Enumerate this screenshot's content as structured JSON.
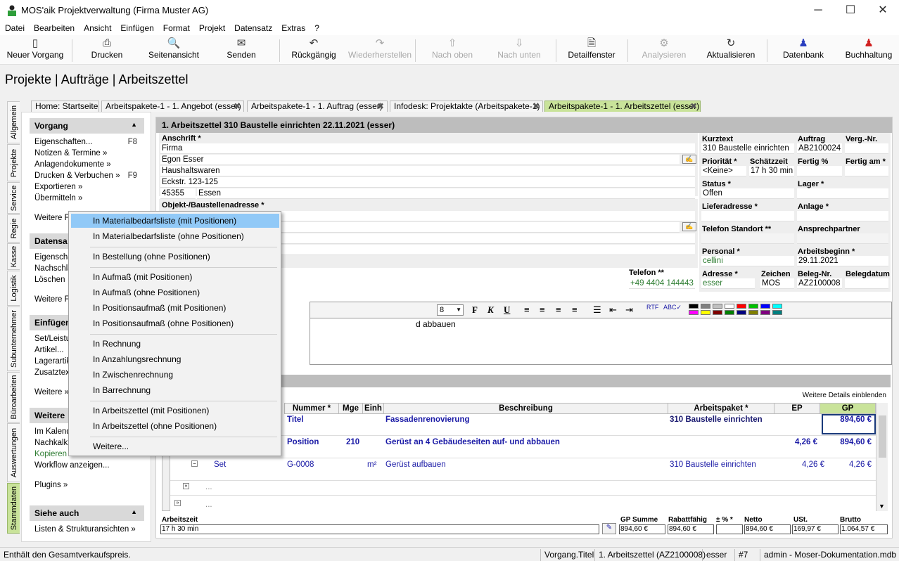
{
  "window": {
    "title": "MOS'aik Projektverwaltung (Firma Muster AG)",
    "minimize": "─",
    "maximize": "☐",
    "close": "✕"
  },
  "menu": [
    "Datei",
    "Bearbeiten",
    "Ansicht",
    "Einfügen",
    "Format",
    "Projekt",
    "Datensatz",
    "Extras",
    "?"
  ],
  "toolbar": [
    {
      "label": "Neuer Vorgang",
      "icon": "new-document-icon",
      "glyph": "▯",
      "enabled": true
    },
    {
      "label": "Drucken",
      "icon": "printer-icon",
      "glyph": "⎙",
      "enabled": true
    },
    {
      "label": "Seitenansicht",
      "icon": "preview-icon",
      "glyph": "🔍",
      "enabled": true
    },
    {
      "label": "Senden",
      "icon": "mail-icon",
      "glyph": "✉",
      "enabled": true
    },
    {
      "label": "Rückgängig",
      "icon": "undo-icon",
      "glyph": "↶",
      "enabled": true
    },
    {
      "label": "Wiederherstellen",
      "icon": "redo-icon",
      "glyph": "↷",
      "enabled": false
    },
    {
      "label": "Nach oben",
      "icon": "arrow-up-icon",
      "glyph": "⇧",
      "enabled": false
    },
    {
      "label": "Nach unten",
      "icon": "arrow-down-icon",
      "glyph": "⇩",
      "enabled": false
    },
    {
      "label": "Detailfenster",
      "icon": "detail-window-icon",
      "glyph": "🗎",
      "enabled": true
    },
    {
      "label": "Analysieren",
      "icon": "analyze-icon",
      "glyph": "⚙",
      "enabled": false
    },
    {
      "label": "Aktualisieren",
      "icon": "refresh-icon",
      "glyph": "↻",
      "enabled": true
    },
    {
      "label": "Datenbank",
      "icon": "database-icon",
      "glyph": "♟",
      "enabled": true
    },
    {
      "label": "Buchhaltung",
      "icon": "accounting-icon",
      "glyph": "♟",
      "enabled": true
    }
  ],
  "breadcrumb": "Projekte | Aufträge | Arbeitszettel",
  "vertical_tabs": [
    "Allgemein",
    "Projekte",
    "Service",
    "Regie",
    "Kasse",
    "Logistik",
    "Subunternehmer",
    "Büroarbeiten",
    "Auswertungen",
    "Stammdaten"
  ],
  "tabs": [
    {
      "label": "Home: Startseite",
      "close": ""
    },
    {
      "label": "Arbeitspakete-1 - 1. Angebot (esser)",
      "close": "✖"
    },
    {
      "label": "Arbeitspakete-1 - 1. Auftrag (esser)",
      "close": "✖"
    },
    {
      "label": "Infodesk: Projektakte (Arbeitspakete-1)",
      "close": "✖"
    },
    {
      "label": "Arbeitspakete-1 - 1. Arbeitszettel (esser)",
      "close": "✖"
    }
  ],
  "left": {
    "vorgang": {
      "title": "Vorgang",
      "items": [
        {
          "label": "Eigenschaften...",
          "key": "F8"
        },
        {
          "label": "Notizen & Termine »",
          "key": ""
        },
        {
          "label": "Anlagendokumente »",
          "key": ""
        },
        {
          "label": "Drucken & Verbuchen »",
          "key": "F9"
        },
        {
          "label": "Exportieren »",
          "key": ""
        },
        {
          "label": "Übermitteln »",
          "key": ""
        }
      ],
      "more": "Weitere Fu"
    },
    "datensatz": {
      "title": "Datensa",
      "items": [
        "Eigenscha",
        "Nachschla",
        "Löschen"
      ],
      "more": "Weitere Fu"
    },
    "einfuegen": {
      "title": "Einfügen",
      "items": [
        "Set/Leistu",
        "Artikel...",
        "Lagerartik",
        "Zusatztex"
      ],
      "more": "Weitere »"
    },
    "weitere": {
      "title": "Weitere",
      "items": [
        "Im Kalend",
        "Nachkalku",
        "Kopieren »",
        "Workflow anzeigen..."
      ],
      "more": "Plugins »"
    },
    "siehe": {
      "title": "Siehe auch",
      "items": [
        "Listen & Strukturansichten »"
      ]
    }
  },
  "main": {
    "title": "1. Arbeitszettel 310 Baustelle einrichten 22.11.2021 (esser)",
    "anschrift_label": "Anschrift *",
    "anschrift": [
      "Firma",
      "Egon Esser",
      "Haushaltswaren",
      "Eckstr. 123-125"
    ],
    "plz": "45355",
    "ort": "Essen",
    "objekt_label": "Objekt-/Baustellenadresse *",
    "telefon_label": "Telefon **",
    "telefon": "+49 4404 144443",
    "kurztext_label": "Kurztext",
    "kurztext": "310 Baustelle einrichten",
    "auftrag_label": "Auftrag",
    "auftrag": "AB2100024",
    "vergnr_label": "Verg.-Nr.",
    "vergnr": "",
    "prioritaet_label": "Priorität *",
    "prioritaet": "<Keine>",
    "schaetzzeit_label": "Schätzzeit",
    "schaetzzeit": "17 h 30 min",
    "fertig_label": "Fertig %",
    "fertig": "",
    "fertigam_label": "Fertig am *",
    "fertigam": "",
    "status_label": "Status *",
    "status": "Offen",
    "lager_label": "Lager *",
    "lager": "",
    "lieferadresse_label": "Lieferadresse *",
    "lieferadresse": "",
    "anlage_label": "Anlage *",
    "anlage": "",
    "telstandort_label": "Telefon Standort **",
    "telstandort": "",
    "ansprechpartner_label": "Ansprechpartner",
    "ansprechpartner": "",
    "personal_label": "Personal *",
    "personal": "cellini",
    "arbeitsbeginn_label": "Arbeitsbeginn *",
    "arbeitsbeginn": "29.11.2021",
    "adresse_label": "Adresse *",
    "adresse": "esser",
    "zeichen_label": "Zeichen",
    "zeichen": "MOS",
    "belegnr_label": "Beleg-Nr.",
    "belegnr": "AZ2100008",
    "belegdatum_label": "Belegdatum",
    "belegdatum": "",
    "fontsize": "8",
    "editor_text": "d abbauen",
    "details_link": "Weitere Details einblenden"
  },
  "palette": [
    "#000000",
    "#808080",
    "#c0c0c0",
    "#ffffff",
    "#ff0000",
    "#00c000",
    "#0000ff",
    "#00ffff",
    "#ff00ff",
    "#ffff00",
    "#800000",
    "#008000",
    "#000080",
    "#808000",
    "#800080",
    "#008080"
  ],
  "grid": {
    "headers": [
      "Nummer *",
      "Mge",
      "Einh",
      "Beschreibung",
      "Arbeitspaket *",
      "EP",
      "GP"
    ],
    "rows": [
      {
        "type": "",
        "nummer": "Titel",
        "mge": "",
        "einh": "",
        "beschreibung": "Fassadenrenovierung",
        "paket": "310 Baustelle einrichten",
        "ep": "",
        "gp": "894,60 €"
      },
      {
        "type": "",
        "nummer": "Position",
        "mge": "210",
        "einh": "",
        "beschreibung": "Gerüst an 4 Gebäudeseiten auf- und abbauen",
        "paket": "",
        "ep": "4,26 €",
        "gp": "894,60 €"
      },
      {
        "type": "Set",
        "nummer": "G-0008",
        "mge": "",
        "einh": "m²",
        "beschreibung": "Gerüst aufbauen",
        "paket": "310 Baustelle einrichten",
        "ep": "4,26 €",
        "gp": "4,26 €"
      },
      {
        "type": "...",
        "nummer": "",
        "mge": "",
        "einh": "",
        "beschreibung": "",
        "paket": "",
        "ep": "",
        "gp": ""
      },
      {
        "type": "...",
        "nummer": "",
        "mge": "",
        "einh": "",
        "beschreibung": "",
        "paket": "",
        "ep": "",
        "gp": ""
      }
    ]
  },
  "footer": {
    "arbeitszeit_label": "Arbeitszeit",
    "arbeitszeit": "17 h 30 min",
    "gpsumme_label": "GP Summe",
    "gpsumme": "894,60 €",
    "rabatt_label": "Rabattfähig",
    "rabatt": "894,60 €",
    "pct_label": "± % *",
    "pct": "",
    "netto_label": "Netto",
    "netto": "894,60 €",
    "ust_label": "USt.",
    "ust": "169,97 €",
    "brutto_label": "Brutto",
    "brutto": "1.064,57 €"
  },
  "context_menu": [
    "In Materialbedarfsliste (mit Positionen)",
    "In Materialbedarfsliste (ohne Positionen)",
    "In Bestellung (ohne Positionen)",
    "In Aufmaß (mit Positionen)",
    "In Aufmaß (ohne Positionen)",
    "In Positionsaufmaß (mit Positionen)",
    "In Positionsaufmaß (ohne Positionen)",
    "In Rechnung",
    "In Anzahlungsrechnung",
    "In Zwischenrechnung",
    "In Barrechnung",
    "In Arbeitszettel (mit Positionen)",
    "In Arbeitszettel (ohne Positionen)",
    "Weitere..."
  ],
  "statusbar": {
    "message": "Enthält den Gesamtverkaufspreis.",
    "field": "Vorgang.Titel",
    "doc": "1. Arbeitszettel (AZ2100008)",
    "user": "esser",
    "num": "#7",
    "db": "admin - Moser-Dokumentation.mdb"
  }
}
